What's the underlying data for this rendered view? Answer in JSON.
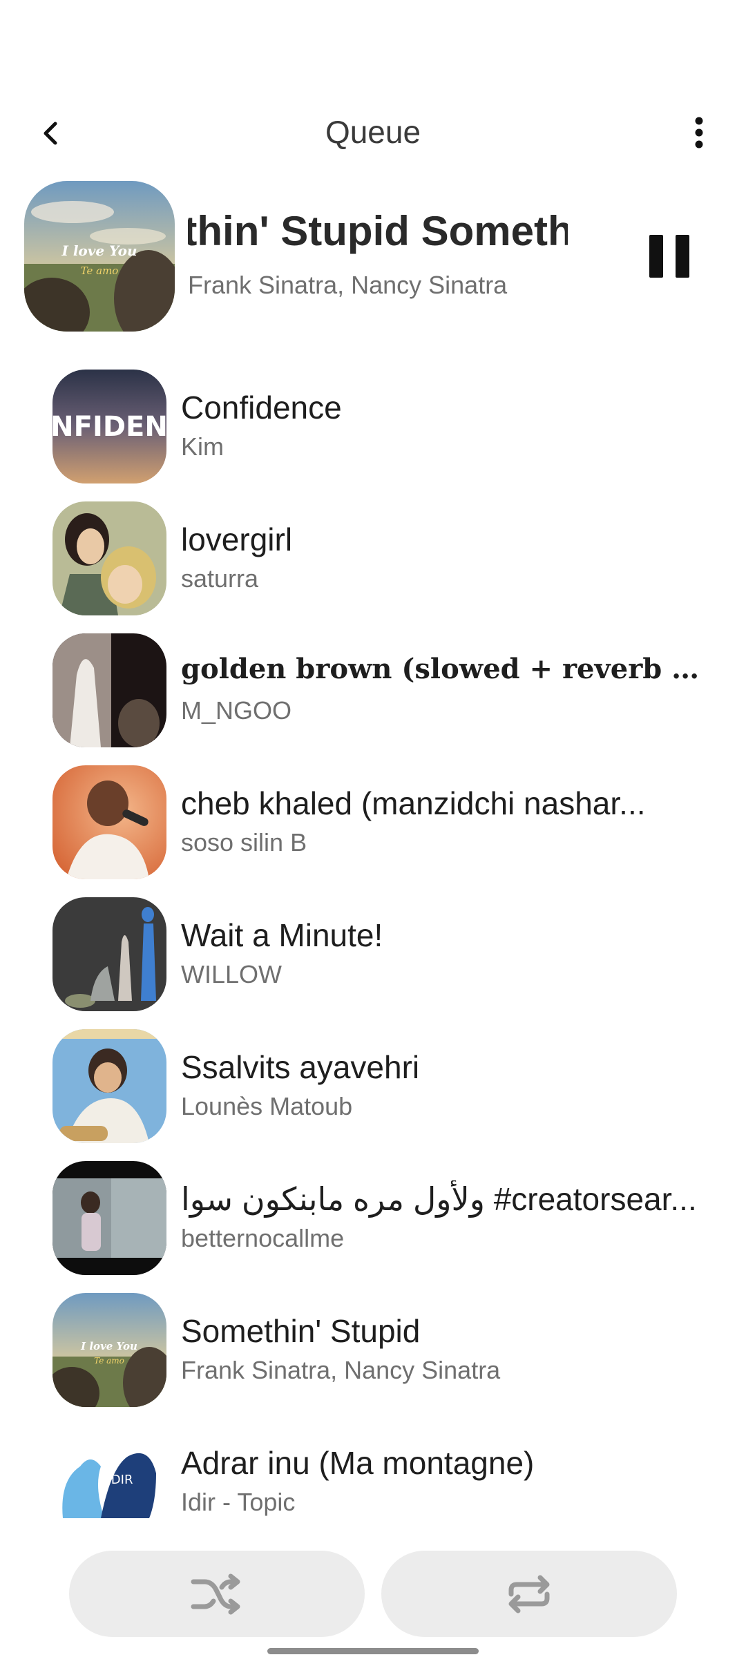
{
  "header": {
    "title": "Queue"
  },
  "now_playing": {
    "title": "Somethin' Stupid   Somethin' Stupid",
    "artist": "Frank Sinatra, Nancy Sinatra",
    "art_text_1": "I love You",
    "art_text_2": "Te amo"
  },
  "queue": [
    {
      "title": "Confidence",
      "artist": "Kim",
      "art_text": "NFIDEN"
    },
    {
      "title": "lovergirl",
      "artist": "saturra"
    },
    {
      "title": "golden brown (slowed + reverb + prolonged ...",
      "artist": "M_NGOO"
    },
    {
      "title": "cheb khaled (manzidchi nashar...",
      "artist": "soso silin B"
    },
    {
      "title": "Wait a Minute!",
      "artist": "WILLOW"
    },
    {
      "title": "Ssalvits ayavehri",
      "artist": "Lounès Matoub"
    },
    {
      "title": "ولأول مره مابنكون سوا #creatorsear...",
      "artist": "betternocallme"
    },
    {
      "title": "Somethin' Stupid",
      "artist": "Frank Sinatra, Nancy Sinatra",
      "art_text_1": "I love You",
      "art_text_2": "Te amo"
    },
    {
      "title": "Adrar inu (Ma montagne)",
      "artist": "Idir - Topic",
      "art_text": "IDIR"
    }
  ]
}
